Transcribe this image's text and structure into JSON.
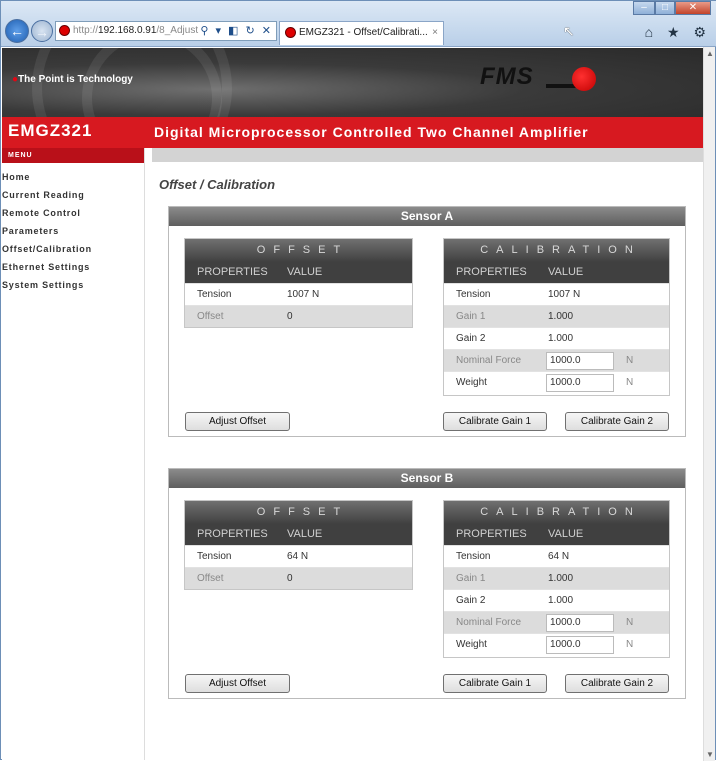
{
  "browser": {
    "url_prefix": "http://",
    "url_host": "192.168.0.91",
    "url_path": "/8_Adjust",
    "tab_title": "EMGZ321 - Offset/Calibrati...",
    "tab_close": "×",
    "address_controls": "⚲ ▾ ◧ ↻ ✕",
    "tools": "⌂ ★ ⚙",
    "window_min": "–",
    "window_max": "□",
    "window_close": "✕"
  },
  "header": {
    "tagline_dot": "●",
    "tagline": "The Point is Technology",
    "logo_text": "FMS",
    "model": "EMGZ321",
    "description": "Digital Microprocessor Controlled Two Channel Amplifier"
  },
  "sidebar": {
    "menu_title": "MENU",
    "items": [
      {
        "label": "Home"
      },
      {
        "label": "Current Reading"
      },
      {
        "label": "Remote Control"
      },
      {
        "label": "Parameters"
      },
      {
        "label": "Offset/Calibration"
      },
      {
        "label": "Ethernet Settings"
      },
      {
        "label": "System Settings"
      }
    ]
  },
  "page": {
    "title": "Offset / Calibration"
  },
  "sensors": [
    {
      "title": "Sensor A",
      "offset": {
        "title": "OFFSET",
        "col_properties": "PROPERTIES",
        "col_value": "VALUE",
        "rows": [
          {
            "label": "Tension",
            "value": "1007 N"
          },
          {
            "label": "Offset",
            "value": "0"
          }
        ]
      },
      "calibration": {
        "title": "CALIBRATION",
        "col_properties": "PROPERTIES",
        "col_value": "VALUE",
        "rows": [
          {
            "label": "Tension",
            "value": "1007 N"
          },
          {
            "label": "Gain 1",
            "value": "1.000"
          },
          {
            "label": "Gain 2",
            "value": "1.000"
          }
        ],
        "nominal_force": {
          "label": "Nominal Force",
          "value": "1000.0",
          "unit": "N"
        },
        "weight": {
          "label": "Weight",
          "value": "1000.0",
          "unit": "N"
        }
      },
      "buttons": {
        "adjust": "Adjust Offset",
        "gain1": "Calibrate Gain 1",
        "gain2": "Calibrate Gain 2"
      }
    },
    {
      "title": "Sensor B",
      "offset": {
        "title": "OFFSET",
        "col_properties": "PROPERTIES",
        "col_value": "VALUE",
        "rows": [
          {
            "label": "Tension",
            "value": "64 N"
          },
          {
            "label": "Offset",
            "value": "0"
          }
        ]
      },
      "calibration": {
        "title": "CALIBRATION",
        "col_properties": "PROPERTIES",
        "col_value": "VALUE",
        "rows": [
          {
            "label": "Tension",
            "value": "64 N"
          },
          {
            "label": "Gain 1",
            "value": "1.000"
          },
          {
            "label": "Gain 2",
            "value": "1.000"
          }
        ],
        "nominal_force": {
          "label": "Nominal Force",
          "value": "1000.0",
          "unit": "N"
        },
        "weight": {
          "label": "Weight",
          "value": "1000.0",
          "unit": "N"
        }
      },
      "buttons": {
        "adjust": "Adjust Offset",
        "gain1": "Calibrate Gain 1",
        "gain2": "Calibrate Gain 2"
      }
    }
  ],
  "colors": {
    "brand_red": "#d71920",
    "menu_red": "#b91019",
    "table_header": "#404040"
  },
  "icons": {
    "back": "back-arrow-icon",
    "forward": "forward-arrow-icon",
    "favicon": "fms-favicon-icon",
    "home": "home-icon",
    "favorites": "star-icon",
    "tools": "gear-icon"
  }
}
